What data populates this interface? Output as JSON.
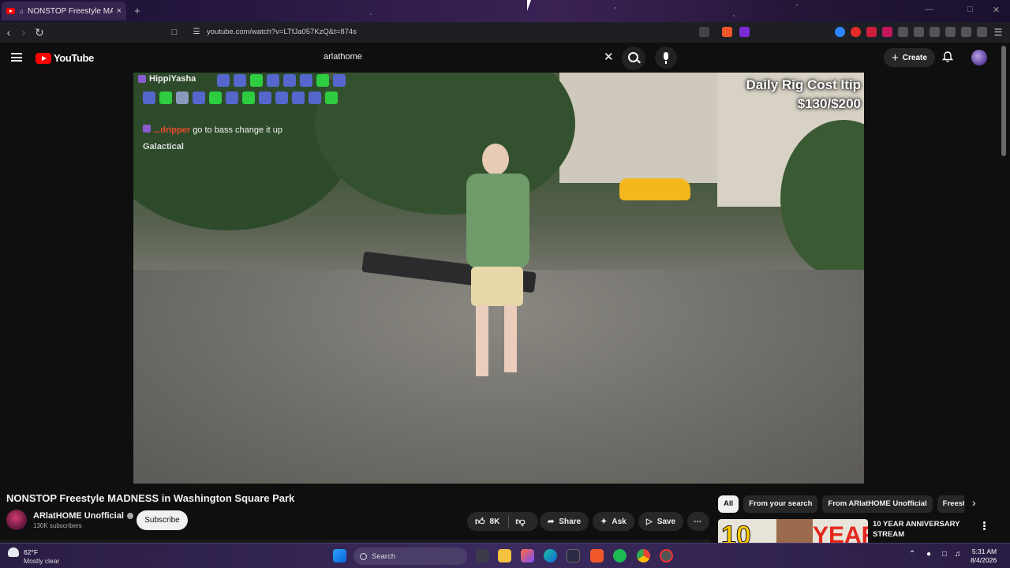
{
  "browser": {
    "tab_title": "NONSTOP Freestyle MADNESS",
    "tab_close": "×",
    "new_tab": "+",
    "url": "youtube.com/watch?v=LTfJa057KzQ&t=874s"
  },
  "youtube": {
    "logo_text": "YouTube",
    "search_query": "arlathome",
    "create_label": "Create"
  },
  "video": {
    "chat": {
      "user1": "HippiYasha",
      "user2": "...dripper",
      "message2": "go to bass change it up",
      "user3": "Galactical"
    },
    "overlay_line1": "Daily Rig Cost Itip",
    "overlay_line2": "$130/$200",
    "title": "NONSTOP Freestyle MADNESS in Washington Square Park",
    "progress": 0.0
  },
  "channel": {
    "name": "ARlatHOME Unofficial",
    "subscribers": "130K subscribers",
    "subscribe_label": "Subscribe"
  },
  "actions": {
    "like_count": "8K",
    "share_label": "Share",
    "ask_label": "Ask",
    "save_label": "Save"
  },
  "chips": [
    "All",
    "From your search",
    "From ARlatHOME Unofficial",
    "Freestyle"
  ],
  "recommendation": {
    "thumb_number": "10",
    "thumb_word": "YEAR",
    "title": "10 YEAR ANNIVERSARY STREAM"
  },
  "taskbar": {
    "temperature": "62°F",
    "condition": "Mostly clear",
    "search_label": "Search",
    "time": "5:31 AM",
    "date": "8/4/2026"
  },
  "colors": {
    "yt_red": "#ff0000",
    "background": "#0f0f0f",
    "chip_active": "#f1f1f1"
  }
}
